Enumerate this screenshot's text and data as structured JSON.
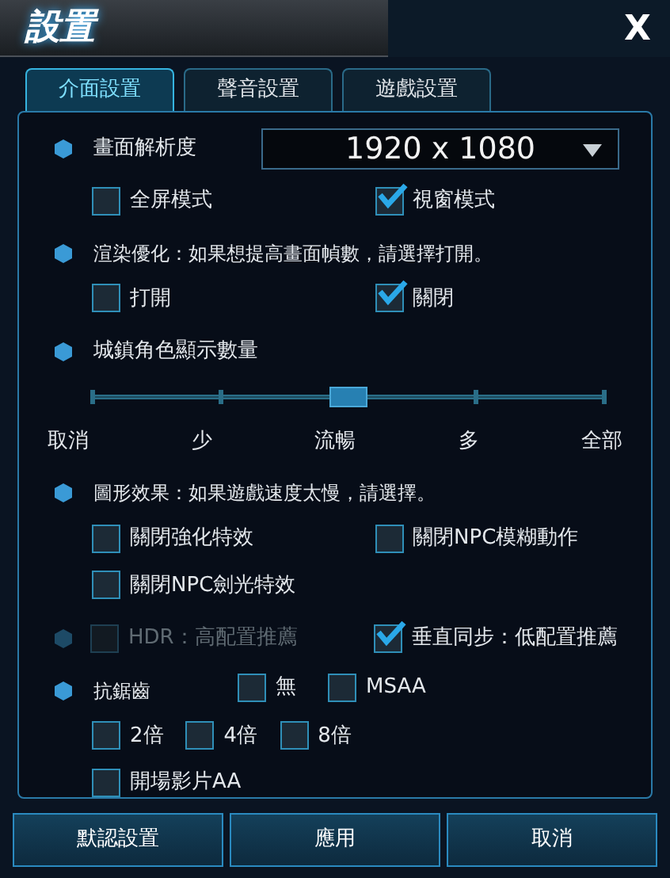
{
  "window": {
    "title": "設置",
    "close": "X"
  },
  "tabs": [
    {
      "label": "介面設置",
      "selected": true
    },
    {
      "label": "聲音設置",
      "selected": false
    },
    {
      "label": "遊戲設置",
      "selected": false
    }
  ],
  "sections": [
    {
      "kind": "dropdown",
      "label": "畫面解析度",
      "value": "1920 x 1080",
      "rows": [
        [
          {
            "label": "全屏模式",
            "checked": false,
            "disabled": false
          },
          {
            "label": "視窗模式",
            "checked": true,
            "disabled": false
          }
        ]
      ]
    },
    {
      "kind": "checks",
      "label": "渲染優化：如果想提高畫面幀數，請選擇打開。",
      "rows": [
        [
          {
            "label": "打開",
            "checked": false,
            "disabled": false
          },
          {
            "label": "關閉",
            "checked": true,
            "disabled": false
          }
        ]
      ]
    },
    {
      "kind": "slider",
      "label": "城鎮角色顯示數量",
      "stops": [
        "取消",
        "少",
        "流暢",
        "多",
        "全部"
      ],
      "level": 0.5
    },
    {
      "kind": "checks",
      "label": "圖形效果：如果遊戲速度太慢，請選擇。",
      "rows": [
        [
          {
            "label": "關閉強化特效",
            "checked": false,
            "disabled": false
          },
          {
            "label": "關閉NPC模糊動作",
            "checked": false,
            "disabled": false
          }
        ],
        [
          {
            "label": "關閉NPC劍光特效",
            "checked": false,
            "disabled": false
          }
        ]
      ]
    },
    {
      "kind": "inline",
      "rows": [
        [
          {
            "label": "HDR：高配置推薦",
            "checked": false,
            "disabled": true
          },
          {
            "label": "垂直同步：低配置推薦",
            "checked": true,
            "disabled": false
          }
        ]
      ]
    },
    {
      "kind": "checks",
      "label": "抗鋸齒",
      "inline": [
        {
          "label": "無",
          "checked": false,
          "disabled": false
        },
        {
          "label": "MSAA",
          "checked": false,
          "disabled": false
        }
      ],
      "rows": [
        [
          {
            "label": "2倍",
            "checked": false,
            "disabled": false
          },
          {
            "label": "4倍",
            "checked": false,
            "disabled": false
          },
          {
            "label": "8倍",
            "checked": false,
            "disabled": false
          }
        ],
        [
          {
            "label": "開場影片AA",
            "checked": false,
            "disabled": false
          }
        ]
      ]
    }
  ],
  "buttons": [
    "默認設置",
    "應用",
    "取消"
  ]
}
